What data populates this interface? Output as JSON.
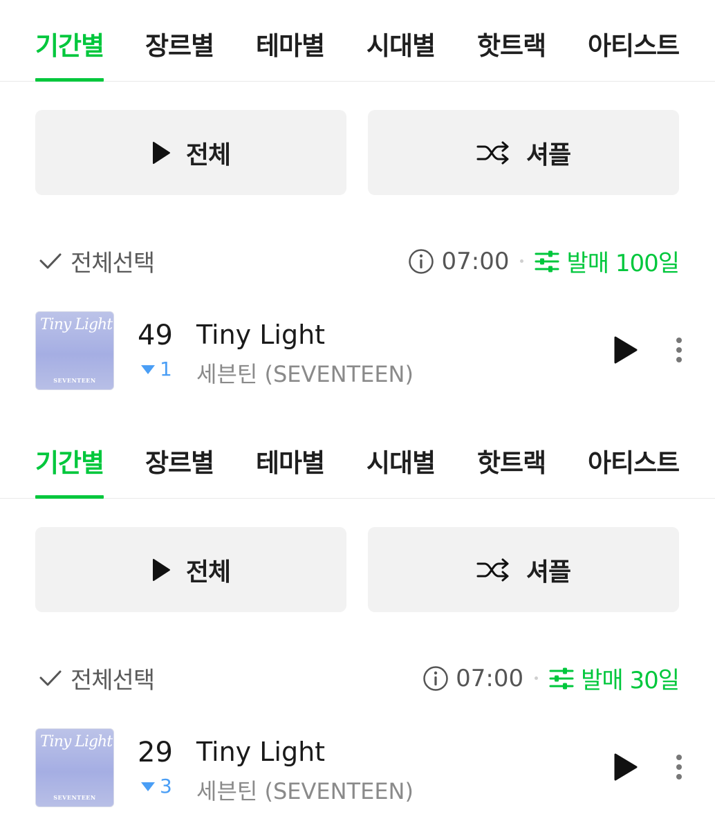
{
  "accent_color": "#00c73c",
  "down_color": "#4a9ef5",
  "sections": [
    {
      "tabs": [
        "기간별",
        "장르별",
        "테마별",
        "시대별",
        "핫트랙",
        "아티스트"
      ],
      "active_tab": "기간별",
      "play_all_label": "전체",
      "shuffle_label": "셔플",
      "select_all_label": "전체선택",
      "info_icon": "info-icon",
      "time": "07:00",
      "filter_label": "발매 100일",
      "track": {
        "rank": "49",
        "rank_change": "1",
        "rank_change_direction": "down",
        "title": "Tiny Light",
        "artist": "세븐틴 (SEVENTEEN)",
        "album_art_title": "Tiny Light",
        "album_art_artist": "SEVENTEEN"
      }
    },
    {
      "tabs": [
        "기간별",
        "장르별",
        "테마별",
        "시대별",
        "핫트랙",
        "아티스트"
      ],
      "active_tab": "기간별",
      "play_all_label": "전체",
      "shuffle_label": "셔플",
      "select_all_label": "전체선택",
      "info_icon": "info-icon",
      "time": "07:00",
      "filter_label": "발매 30일",
      "track": {
        "rank": "29",
        "rank_change": "3",
        "rank_change_direction": "down",
        "title": "Tiny Light",
        "artist": "세븐틴 (SEVENTEEN)",
        "album_art_title": "Tiny Light",
        "album_art_artist": "SEVENTEEN"
      }
    }
  ]
}
